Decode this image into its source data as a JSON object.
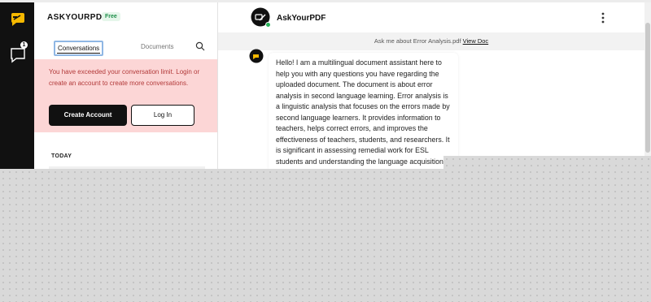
{
  "sidebar": {
    "brand": "ASKYOURPDF",
    "badge": "Free",
    "tabs": {
      "conversations": "Conversations",
      "documents": "Documents"
    },
    "limit": {
      "message": "You have exceeded your conversation limit. Login or create an account to create more conversations.",
      "create_label": "Create Account",
      "login_label": "Log In"
    },
    "section_today": "TODAY"
  },
  "rail": {
    "notification_count": "1"
  },
  "chat": {
    "title": "AskYourPDF",
    "info_prefix": "Ask me about Error Analysis.pdf ",
    "info_link": "View Doc",
    "message": "Hello! I am a multilingual document assistant here to help you with any questions you have regarding the uploaded document. The document is about error analysis in second language learning. Error analysis is a linguistic analysis that focuses on the errors made by second language learners. It provides information to teachers, helps correct errors, and improves the effectiveness of teachers, students, and researchers. It is significant in assessing remedial work for ESL students and understanding the language acquisition process. Error analysis has two"
  },
  "colors": {
    "brand_yellow": "#f5b800",
    "alert_bg": "#fcd6d6",
    "alert_text": "#b23a3a",
    "online": "#27b35a"
  },
  "icons": [
    "app-logo-icon",
    "chat-icon",
    "search-icon",
    "menu-icon",
    "avatar-icon"
  ]
}
